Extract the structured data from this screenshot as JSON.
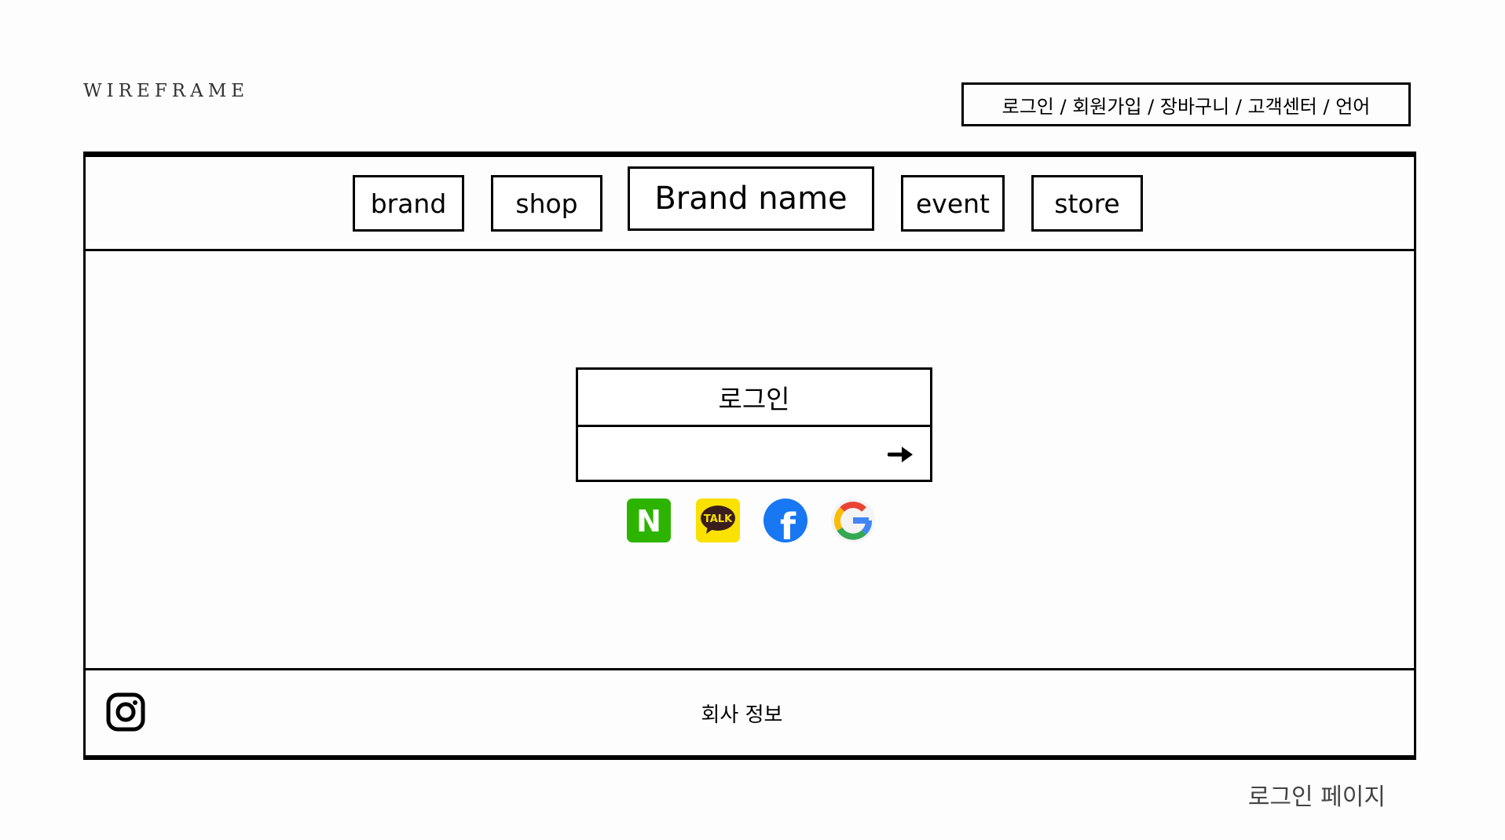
{
  "header": {
    "wordmark": "WIREFRAME",
    "utility_links": "로그인 / 회원가입 / 장바구니 / 고객센터 / 언어"
  },
  "nav": {
    "items": [
      {
        "label": "brand"
      },
      {
        "label": "shop"
      },
      {
        "label": "Brand name"
      },
      {
        "label": "event"
      },
      {
        "label": "store"
      }
    ]
  },
  "login": {
    "title": "로그인",
    "input_value": "",
    "submit_icon": "arrow-right-icon"
  },
  "social": [
    {
      "icon": "naver-icon",
      "letter": "N",
      "color": "#2DB400"
    },
    {
      "icon": "kakaotalk-icon",
      "letter": "TALK",
      "color": "#FAE100"
    },
    {
      "icon": "facebook-icon",
      "letter": "f",
      "color": "#1877F2"
    },
    {
      "icon": "google-icon",
      "letter": "G",
      "color": "#4285F4"
    }
  ],
  "footer": {
    "company_info": "회사 정보",
    "social_icon": "instagram-icon"
  },
  "caption": "로그인 페이지"
}
